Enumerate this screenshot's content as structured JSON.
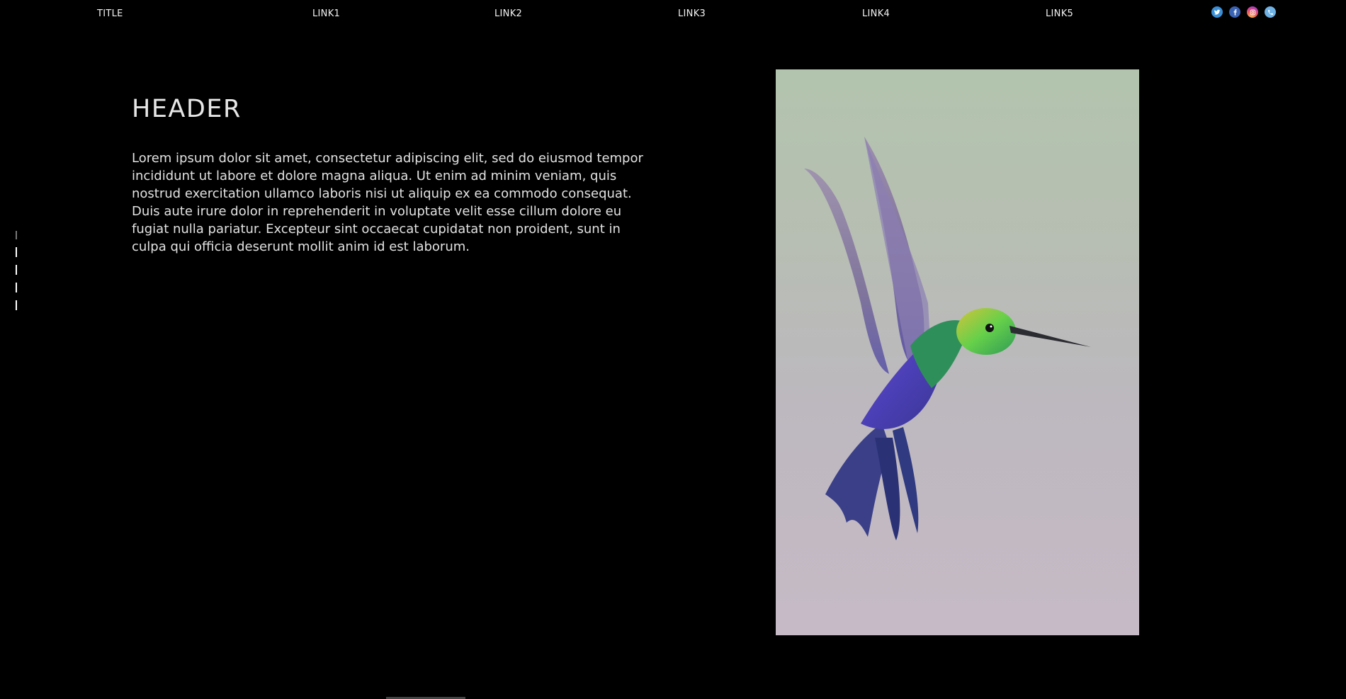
{
  "nav": {
    "title": "TITLE",
    "links": [
      "LINK1",
      "LINK2",
      "LINK3",
      "LINK4",
      "LINK5"
    ]
  },
  "social": {
    "icons": [
      "twitter-icon",
      "facebook-icon",
      "instagram-icon",
      "phone-icon"
    ],
    "colors": [
      "#3a8fd6",
      "#3b63b4",
      "#e1306c",
      "#6fb2e6"
    ]
  },
  "main": {
    "header": "HEADER",
    "body": "Lorem ipsum dolor sit amet, consectetur adipiscing elit, sed do eiusmod tempor incididunt ut labore et dolore magna aliqua. Ut enim ad minim veniam, quis nostrud exercitation ullamco laboris nisi ut aliquip ex ea commodo consequat. Duis aute irure dolor in reprehenderit in voluptate velit esse cillum dolore eu fugiat nulla pariatur. Excepteur sint occaecat cupidatat non proident, sunt in culpa qui officia deserunt mollit anim id est laborum."
  },
  "image": {
    "subject": "hummingbird-in-flight"
  },
  "colors": {
    "background": "#000000",
    "text": "#e2e2e2"
  }
}
